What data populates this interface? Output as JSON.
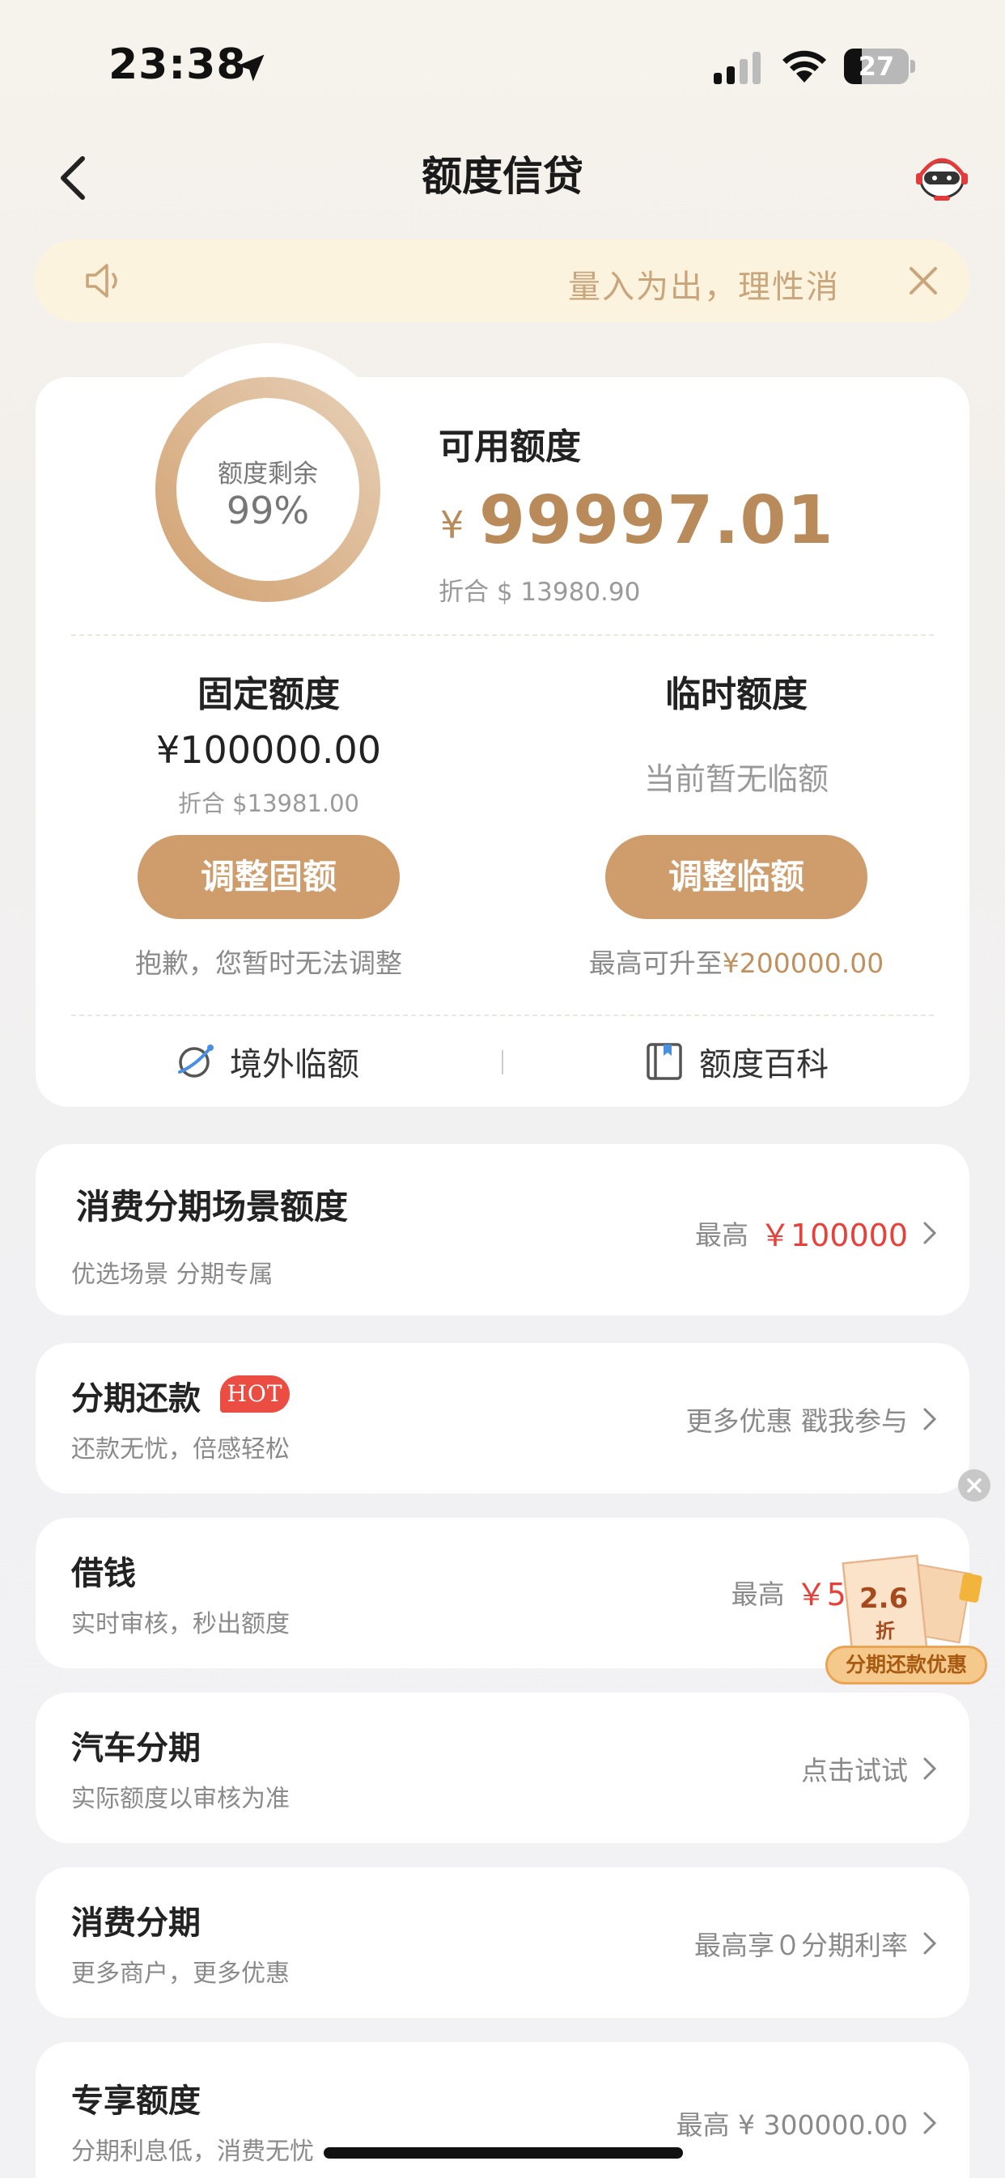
{
  "status_bar": {
    "time": "23:38",
    "battery": "27",
    "battery_level_pct": 27
  },
  "nav": {
    "title": "额度信贷"
  },
  "notice": {
    "text": "量入为出，理性消"
  },
  "summary": {
    "ring_label": "额度剩余",
    "ring_value": "99%",
    "ring_fraction": 0.99,
    "available_title": "可用额度",
    "currency_symbol": "¥",
    "available_amount": "99997.01",
    "available_usd": "折合 $ 13980.90",
    "fixed": {
      "title": "固定额度",
      "amount": "¥100000.00",
      "usd": "折合 $13981.00",
      "button": "调整固额",
      "note": "抱歉，您暂时无法调整"
    },
    "temporary": {
      "title": "临时额度",
      "status": "当前暂无临额",
      "button": "调整临额",
      "note_prefix": "最高可升至",
      "note_amount": "¥200000.00"
    },
    "links": {
      "overseas": "境外临额",
      "encyclopedia": "额度百科"
    }
  },
  "rows": {
    "scene": {
      "title": "消费分期场景额度",
      "sub": "优选场景 分期专属",
      "right_prefix": "最高",
      "right_amount": "￥100000"
    },
    "installment_repay": {
      "title": "分期还款",
      "badge": "HOT",
      "sub": "还款无忧，倍感轻松",
      "right": "更多优惠 戳我参与"
    },
    "borrow": {
      "title": "借钱",
      "sub": "实时审核，秒出额度",
      "right_prefix": "最高",
      "right_amount": "￥50"
    },
    "car": {
      "title": "汽车分期",
      "sub": "实际额度以审核为准",
      "right": "点击试试"
    },
    "consumer": {
      "title": "消费分期",
      "sub": "更多商户，更多优惠",
      "right": "最高享０分期利率"
    },
    "exclusive": {
      "title": "专享额度",
      "sub": "分期利息低，消费无忧",
      "right": "最高 ¥ 300000.00"
    }
  },
  "promo": {
    "discount": "2.6",
    "unit": "折",
    "label": "分期还款优惠"
  },
  "colors": {
    "accent": "#cf9d6c",
    "gold_text": "#b98a5a",
    "red": "#e8413a",
    "notice_bg": "#fcf3df"
  },
  "icons": [
    "location-arrow-icon",
    "signal-icon",
    "wifi-icon",
    "battery-icon",
    "back-chevron-icon",
    "customer-service-icon",
    "speaker-icon",
    "close-icon",
    "planet-icon",
    "book-icon",
    "chevron-right-icon"
  ]
}
